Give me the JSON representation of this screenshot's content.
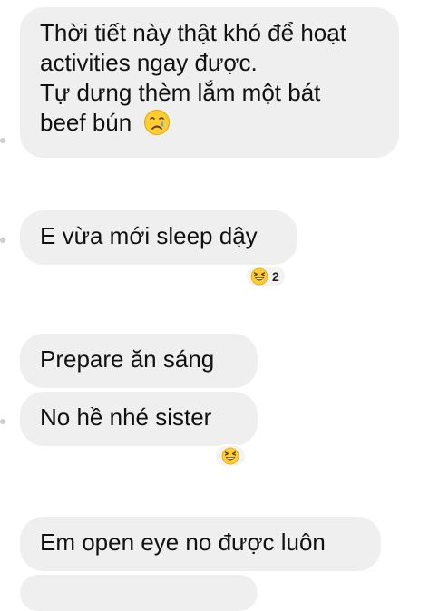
{
  "messages": [
    {
      "id": "m1",
      "lines": [
        "Thời tiết này thật khó để hoạt",
        "activities ngay được.",
        "Tự dưng thèm lắm một bát",
        "beef bún"
      ],
      "emoji": "crying-face"
    },
    {
      "id": "m2",
      "text": "E vừa mới sleep dậy",
      "reaction": {
        "emoji": "grinning-squinting-face",
        "count": "2"
      }
    },
    {
      "id": "m3",
      "text": "Prepare ăn sáng"
    },
    {
      "id": "m4",
      "text": "No hề nhé sister",
      "reaction": {
        "emoji": "grinning-squinting-face"
      }
    },
    {
      "id": "m5",
      "text": "Em open eye no được luôn"
    }
  ],
  "colors": {
    "bubble": "#efefef",
    "text": "#111111",
    "emoji_yellow": "#ffcc33",
    "reaction_bg": "#f3f3f3"
  }
}
